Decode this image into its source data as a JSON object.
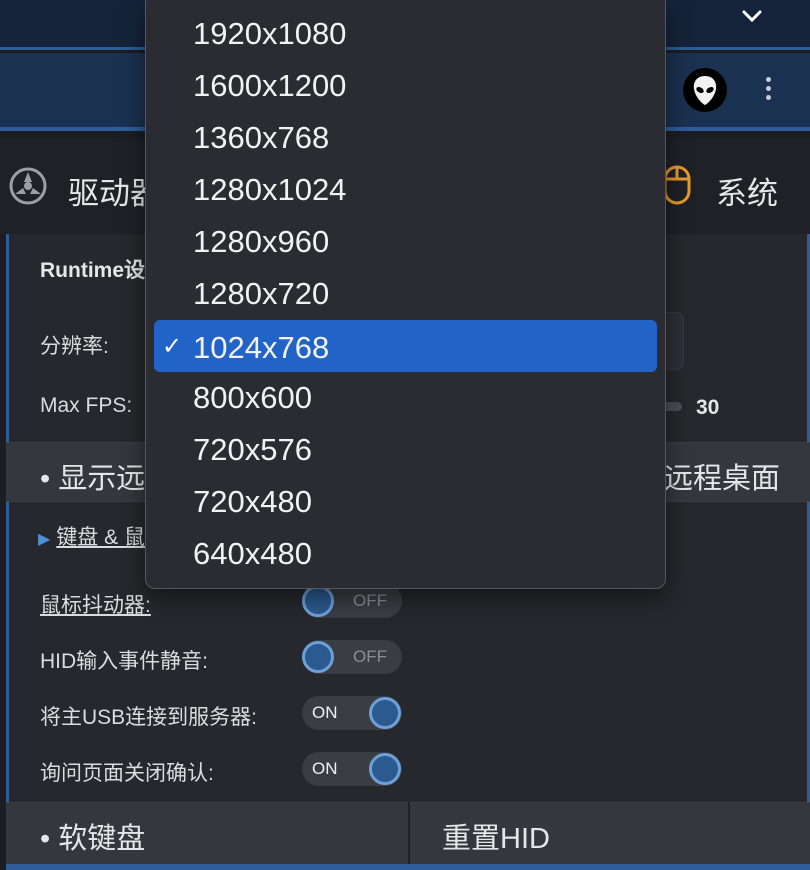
{
  "header": {
    "collapse_icon": "chevron-down-icon",
    "avatar_icon": "alien-head-icon",
    "menu_icon": "more-vertical-icon"
  },
  "tabs": {
    "driver": "驱动器",
    "system": "系统"
  },
  "runtime": {
    "title": "Runtime设置",
    "resolution_label": "分辨率:",
    "fps_label": "Max FPS:",
    "fps_value": "30"
  },
  "sections": {
    "display": "• 显示远程桌面",
    "remote_desktop": "远程桌面",
    "keyboard_mouse": "键盘 & 鼠标"
  },
  "settings": [
    {
      "label": "鼠标抖动器:",
      "state": "OFF"
    },
    {
      "label": "HID输入事件静音:",
      "state": "OFF"
    },
    {
      "label": "将主USB连接到服务器:",
      "state": "ON"
    },
    {
      "label": "询问页面关闭确认:",
      "state": "ON"
    }
  ],
  "bottom": {
    "soft_keyboard": "• 软键盘",
    "reset_hid": "重置HID"
  },
  "resolution_dropdown": {
    "selected": "1024x768",
    "options": [
      "1920x1080",
      "1600x1200",
      "1360x768",
      "1280x1024",
      "1280x960",
      "1280x720",
      "1024x768",
      "800x600",
      "720x576",
      "720x480",
      "640x480"
    ]
  },
  "colors": {
    "accent": "#2f5d99",
    "selected": "#2163c6",
    "system_icon": "#e89a2c"
  }
}
